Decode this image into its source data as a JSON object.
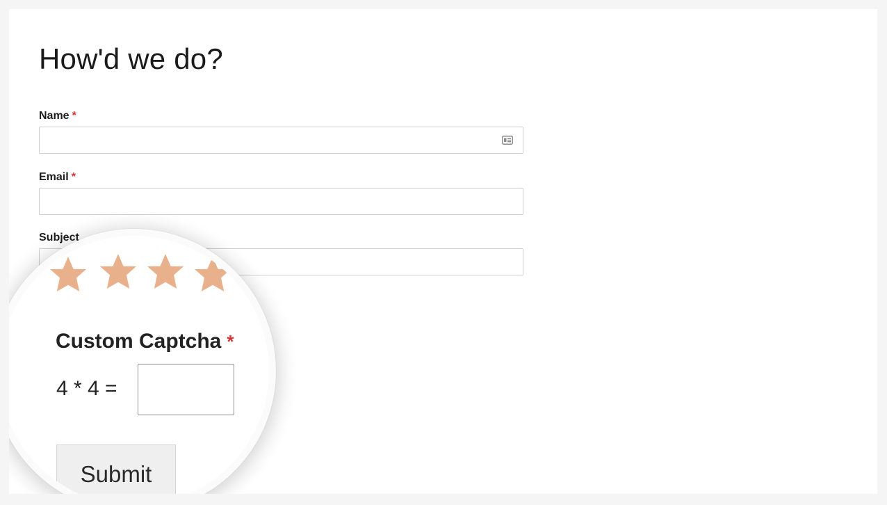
{
  "form": {
    "title": "How'd we do?",
    "required_marker": "*",
    "fields": {
      "name": {
        "label": "Name",
        "value": "",
        "placeholder": "",
        "icon": "contact-card-icon"
      },
      "email": {
        "label": "Email",
        "value": "",
        "placeholder": ""
      },
      "subject": {
        "label": "Subject",
        "value": "",
        "placeholder": ""
      }
    }
  },
  "magnifier": {
    "rating": {
      "icon": "star-icon",
      "color": "#e9b18b",
      "visible_stars": 4
    },
    "captcha": {
      "label": "Custom Captcha",
      "question": "4 * 4 =",
      "answer_value": ""
    },
    "submit_label": "Submit"
  },
  "colors": {
    "required": "#d63638",
    "star": "#e9b18b",
    "input_border": "#cfcfcf",
    "background": "#f5f5f5"
  }
}
